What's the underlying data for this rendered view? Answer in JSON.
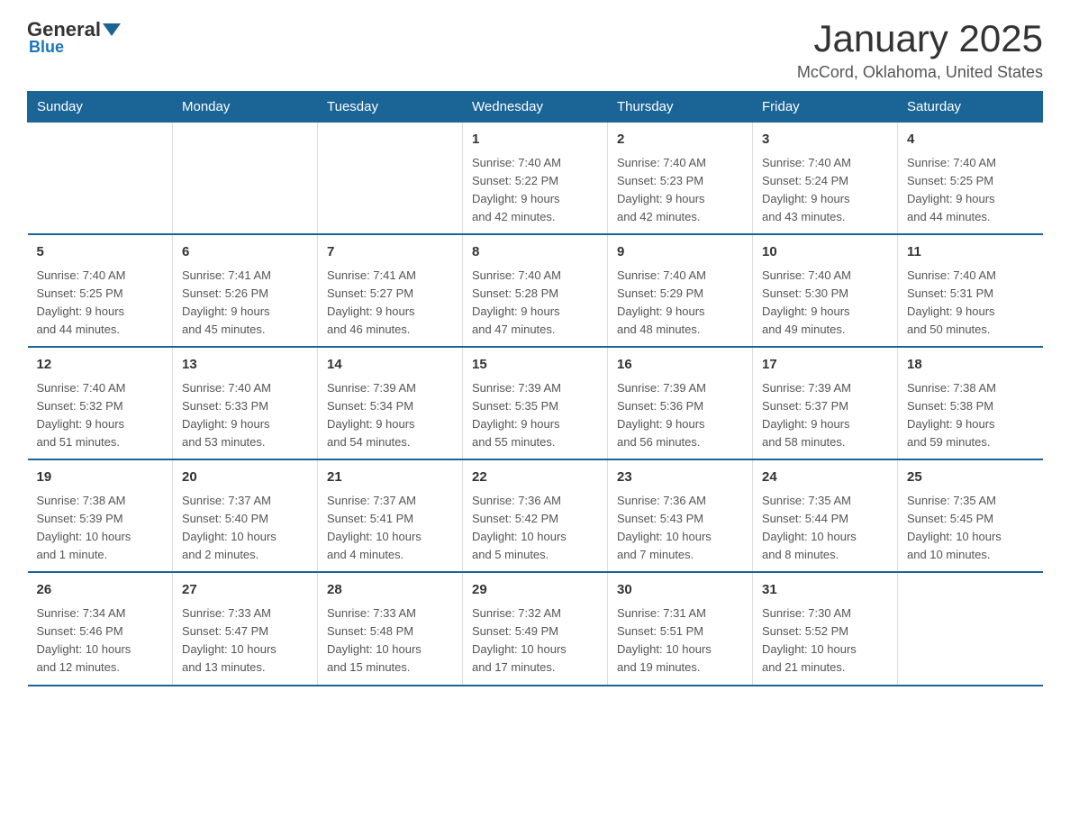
{
  "logo": {
    "general": "General",
    "blue": "Blue"
  },
  "header": {
    "title": "January 2025",
    "subtitle": "McCord, Oklahoma, United States"
  },
  "weekdays": [
    "Sunday",
    "Monday",
    "Tuesday",
    "Wednesday",
    "Thursday",
    "Friday",
    "Saturday"
  ],
  "weeks": [
    [
      {
        "day": "",
        "info": ""
      },
      {
        "day": "",
        "info": ""
      },
      {
        "day": "",
        "info": ""
      },
      {
        "day": "1",
        "info": "Sunrise: 7:40 AM\nSunset: 5:22 PM\nDaylight: 9 hours\nand 42 minutes."
      },
      {
        "day": "2",
        "info": "Sunrise: 7:40 AM\nSunset: 5:23 PM\nDaylight: 9 hours\nand 42 minutes."
      },
      {
        "day": "3",
        "info": "Sunrise: 7:40 AM\nSunset: 5:24 PM\nDaylight: 9 hours\nand 43 minutes."
      },
      {
        "day": "4",
        "info": "Sunrise: 7:40 AM\nSunset: 5:25 PM\nDaylight: 9 hours\nand 44 minutes."
      }
    ],
    [
      {
        "day": "5",
        "info": "Sunrise: 7:40 AM\nSunset: 5:25 PM\nDaylight: 9 hours\nand 44 minutes."
      },
      {
        "day": "6",
        "info": "Sunrise: 7:41 AM\nSunset: 5:26 PM\nDaylight: 9 hours\nand 45 minutes."
      },
      {
        "day": "7",
        "info": "Sunrise: 7:41 AM\nSunset: 5:27 PM\nDaylight: 9 hours\nand 46 minutes."
      },
      {
        "day": "8",
        "info": "Sunrise: 7:40 AM\nSunset: 5:28 PM\nDaylight: 9 hours\nand 47 minutes."
      },
      {
        "day": "9",
        "info": "Sunrise: 7:40 AM\nSunset: 5:29 PM\nDaylight: 9 hours\nand 48 minutes."
      },
      {
        "day": "10",
        "info": "Sunrise: 7:40 AM\nSunset: 5:30 PM\nDaylight: 9 hours\nand 49 minutes."
      },
      {
        "day": "11",
        "info": "Sunrise: 7:40 AM\nSunset: 5:31 PM\nDaylight: 9 hours\nand 50 minutes."
      }
    ],
    [
      {
        "day": "12",
        "info": "Sunrise: 7:40 AM\nSunset: 5:32 PM\nDaylight: 9 hours\nand 51 minutes."
      },
      {
        "day": "13",
        "info": "Sunrise: 7:40 AM\nSunset: 5:33 PM\nDaylight: 9 hours\nand 53 minutes."
      },
      {
        "day": "14",
        "info": "Sunrise: 7:39 AM\nSunset: 5:34 PM\nDaylight: 9 hours\nand 54 minutes."
      },
      {
        "day": "15",
        "info": "Sunrise: 7:39 AM\nSunset: 5:35 PM\nDaylight: 9 hours\nand 55 minutes."
      },
      {
        "day": "16",
        "info": "Sunrise: 7:39 AM\nSunset: 5:36 PM\nDaylight: 9 hours\nand 56 minutes."
      },
      {
        "day": "17",
        "info": "Sunrise: 7:39 AM\nSunset: 5:37 PM\nDaylight: 9 hours\nand 58 minutes."
      },
      {
        "day": "18",
        "info": "Sunrise: 7:38 AM\nSunset: 5:38 PM\nDaylight: 9 hours\nand 59 minutes."
      }
    ],
    [
      {
        "day": "19",
        "info": "Sunrise: 7:38 AM\nSunset: 5:39 PM\nDaylight: 10 hours\nand 1 minute."
      },
      {
        "day": "20",
        "info": "Sunrise: 7:37 AM\nSunset: 5:40 PM\nDaylight: 10 hours\nand 2 minutes."
      },
      {
        "day": "21",
        "info": "Sunrise: 7:37 AM\nSunset: 5:41 PM\nDaylight: 10 hours\nand 4 minutes."
      },
      {
        "day": "22",
        "info": "Sunrise: 7:36 AM\nSunset: 5:42 PM\nDaylight: 10 hours\nand 5 minutes."
      },
      {
        "day": "23",
        "info": "Sunrise: 7:36 AM\nSunset: 5:43 PM\nDaylight: 10 hours\nand 7 minutes."
      },
      {
        "day": "24",
        "info": "Sunrise: 7:35 AM\nSunset: 5:44 PM\nDaylight: 10 hours\nand 8 minutes."
      },
      {
        "day": "25",
        "info": "Sunrise: 7:35 AM\nSunset: 5:45 PM\nDaylight: 10 hours\nand 10 minutes."
      }
    ],
    [
      {
        "day": "26",
        "info": "Sunrise: 7:34 AM\nSunset: 5:46 PM\nDaylight: 10 hours\nand 12 minutes."
      },
      {
        "day": "27",
        "info": "Sunrise: 7:33 AM\nSunset: 5:47 PM\nDaylight: 10 hours\nand 13 minutes."
      },
      {
        "day": "28",
        "info": "Sunrise: 7:33 AM\nSunset: 5:48 PM\nDaylight: 10 hours\nand 15 minutes."
      },
      {
        "day": "29",
        "info": "Sunrise: 7:32 AM\nSunset: 5:49 PM\nDaylight: 10 hours\nand 17 minutes."
      },
      {
        "day": "30",
        "info": "Sunrise: 7:31 AM\nSunset: 5:51 PM\nDaylight: 10 hours\nand 19 minutes."
      },
      {
        "day": "31",
        "info": "Sunrise: 7:30 AM\nSunset: 5:52 PM\nDaylight: 10 hours\nand 21 minutes."
      },
      {
        "day": "",
        "info": ""
      }
    ]
  ]
}
